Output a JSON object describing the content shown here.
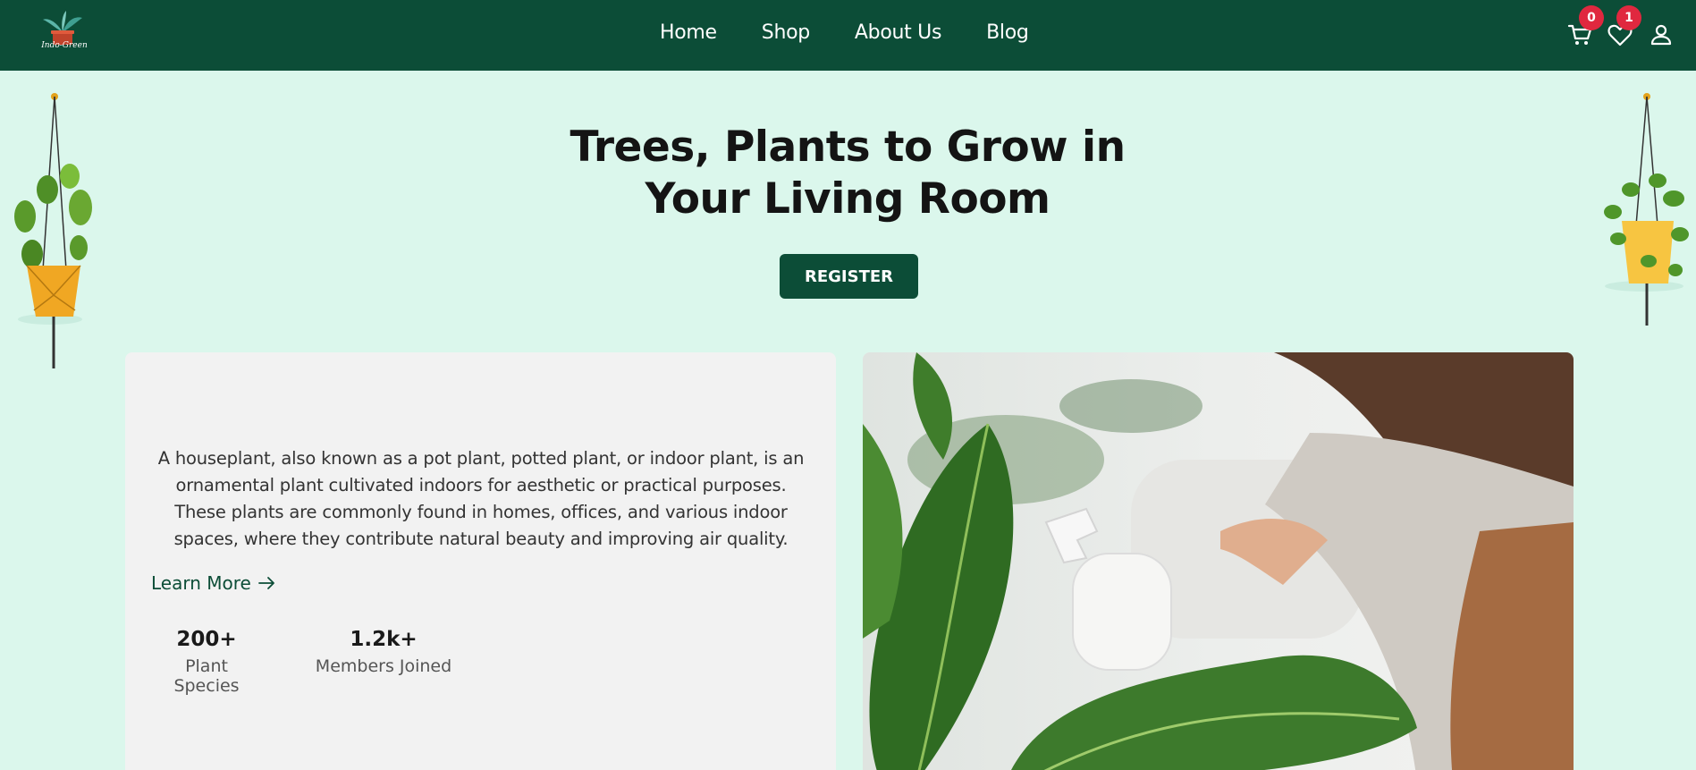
{
  "brand": {
    "logo_text": "Indo-Green"
  },
  "nav": {
    "items": [
      {
        "label": "Home"
      },
      {
        "label": "Shop"
      },
      {
        "label": "About Us"
      },
      {
        "label": "Blog"
      }
    ],
    "cart_count": "0",
    "wishlist_count": "1"
  },
  "hero": {
    "title_line1": "Trees, Plants to Grow in",
    "title_line2": "Your Living Room",
    "register_label": "REGISTER"
  },
  "info": {
    "description": "A houseplant, also known as a pot plant, potted plant, or indoor plant, is an ornamental plant cultivated indoors for aesthetic or practical purposes. These plants are commonly found in homes, offices, and various indoor spaces, where they contribute natural beauty and improving air quality.",
    "learn_more": "Learn More",
    "stats": [
      {
        "value": "200+",
        "label": "Plant Species"
      },
      {
        "value": "1.2k+",
        "label": "Members Joined"
      }
    ]
  },
  "colors": {
    "header_bg": "#0c4d37",
    "page_bg": "#dbf7ec",
    "badge": "#e0283f",
    "card_bg": "#f2f2f2"
  },
  "icons": [
    "cart-icon",
    "heart-icon",
    "user-icon",
    "arrow-right-icon",
    "plant-logo-icon"
  ]
}
